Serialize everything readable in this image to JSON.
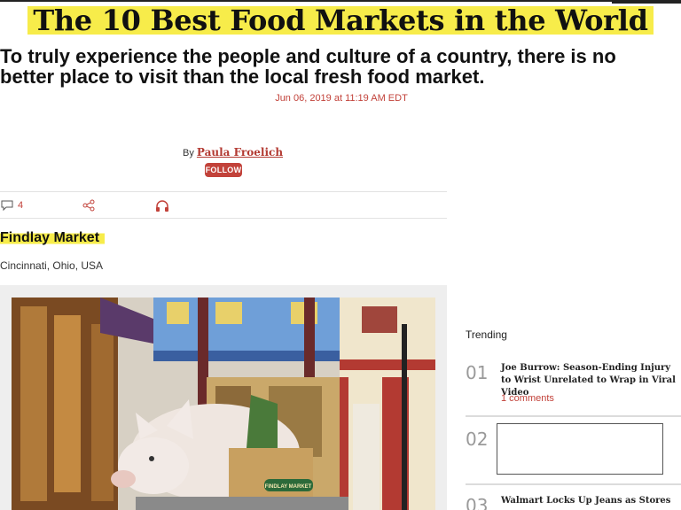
{
  "article": {
    "headline": "The 10 Best Food Markets in the World",
    "dek": "To truly experience the people and culture of a country, there is no better place to visit than the local fresh food market.",
    "timestamp": "Jun 06, 2019 at 11:19 AM EDT",
    "byline_prefix": "By",
    "author": "Paula Froelich",
    "follow_label": "FOLLOW"
  },
  "share_bar": {
    "comment_count": "4",
    "icons": [
      "comment-icon",
      "share-icon",
      "headphones-icon"
    ]
  },
  "section": {
    "title": "Findlay Market",
    "location": "Cincinnati, Ohio, USA",
    "photo_sign_text": "FINDLAY MARKET"
  },
  "trending": {
    "label": "Trending",
    "items": [
      {
        "number": "01",
        "title": "Joe Burrow: Season-Ending Injury to Wrist Unrelated to Wrap in Viral Video",
        "comments": "1 comments"
      },
      {
        "number": "02",
        "title": "",
        "comments": ""
      },
      {
        "number": "03",
        "title": "Walmart Locks Up Jeans as Stores",
        "comments": ""
      }
    ]
  },
  "colors": {
    "accent": "#c2423a",
    "highlight": "#f7ec4a"
  }
}
